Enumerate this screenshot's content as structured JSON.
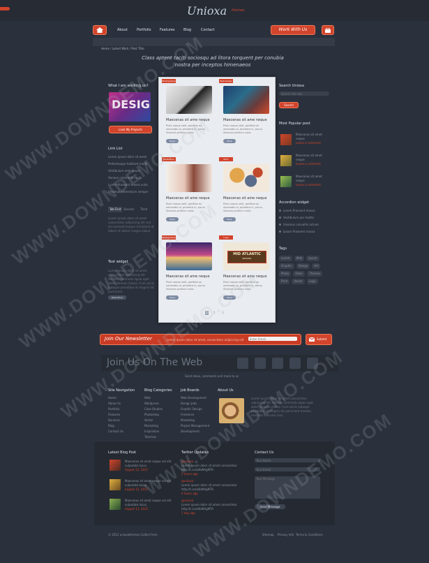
{
  "brand": {
    "logo": "Unioxa",
    "tagline": "themes"
  },
  "nav": {
    "items": [
      "About",
      "Portfolio",
      "Features",
      "Blog",
      "Contact"
    ],
    "cta": "Work With Us"
  },
  "breadcrumb": "Home / Latest Work / Post Title",
  "hero": {
    "line1": "Class aptent taciti sociosqu ad litora torquent per conubia",
    "line2": "nostra per inceptos himenaeos"
  },
  "left": {
    "working_title": "What I am working on?",
    "design_word": "DESIG",
    "working_button": "Look My Projects",
    "links_title": "Link List",
    "links": [
      "Lorem ipsum dolor sit amet",
      "Pellentesque habitant morbi",
      "Vestibulum ante ipsum",
      "Aenean commodo ligula",
      "Lorem Praesent massa nulla",
      "Vivamus elementum semper"
    ],
    "tabs": [
      "Tab First",
      "Second",
      "Third"
    ],
    "tab_text": "Lorem ipsum dolor sit amet consectetur adipiscing elit sed do eiusmod tempor incididunt ut labore et dolore magna aliqua",
    "text_widget_title": "Text widget",
    "text_widget_body": "Lorem ipsum dolor sit amet, consectetur adipiscing elit. Aenean commodo ligula eget dolor. Aenean massa. Cum sociis natoque penatibus et magnis dis parturient.",
    "text_widget_button": "Read More"
  },
  "cards": [
    {
      "title": "Maecenas sit ame neque",
      "excerpt": "Proin neque velit, porttitor ac venenatis ut, pharetra in, purus. Vivamus pretium nulla.",
      "more": "More",
      "tag": "Photography"
    },
    {
      "title": "Maecenas sit ame neque",
      "excerpt": "Proin neque velit, porttitor ac venenatis ut, pharetra in, purus. Vivamus pretium nulla.",
      "more": "More",
      "tag": "Web Design"
    },
    {
      "title": "Maecenas sit ame neque",
      "excerpt": "Proin neque velit, porttitor ac venenatis ut, pharetra in, purus. Vivamus pretium nulla.",
      "more": "More",
      "tag": "Illustration"
    },
    {
      "title": "Maecenas sit ame neque",
      "excerpt": "Proin neque velit, porttitor ac venenatis ut, pharetra in, purus. Vivamus pretium nulla.",
      "more": "More",
      "tag": "Print"
    },
    {
      "title": "Maecenas sit ame neque",
      "excerpt": "Proin neque velit, porttitor ac venenatis ut, pharetra in, purus. Vivamus pretium nulla.",
      "more": "More",
      "tag": "Photography"
    },
    {
      "title": "Maecenas sit ame neque",
      "excerpt": "Proin neque velit, porttitor ac venenatis ut, pharetra in, purus. Vivamus pretium nulla.",
      "more": "More",
      "tag": "Logo"
    }
  ],
  "badge_text": {
    "line1": "MID ATLANTIC",
    "line2": "BREWER"
  },
  "pager": [
    "1",
    "2",
    "3"
  ],
  "right": {
    "search_title": "Search Unioxa",
    "search_placeholder": "Search the site",
    "search_button": "Search",
    "popular_title": "Most Popular post",
    "popular": [
      {
        "title": "Maecenas sit amet neque",
        "meta": "Leave a comment"
      },
      {
        "title": "Maecenas sit amet neque",
        "meta": "Leave a comment"
      },
      {
        "title": "Maecenas sit amet neque",
        "meta": "Leave a comment"
      }
    ],
    "accordion_title": "Accordion widget",
    "accordion": [
      "Lorem Praesent massa",
      "Vestibulum per mattis",
      "Vivamus convallis rutrum",
      "Ipsum Praesent massa"
    ],
    "tags_title": "Tags",
    "tags": [
      "Lorem",
      "Web",
      "Ipsum",
      "Graphic",
      "Design",
      "Art",
      "Photo",
      "Dolor",
      "Themes",
      "Print",
      "Vector",
      "Logo"
    ]
  },
  "newsletter": {
    "title": "Join Our Newsletter",
    "text": "Lorem ipsum dolor sit amet, consectetur adipiscing elit",
    "placeholder": "Enter Email",
    "button": "Submit"
  },
  "social": {
    "title": "Join Us On The Web",
    "sub": "Send ideas, comments and more to us"
  },
  "footer_cols": [
    {
      "title": "Site Navigation",
      "items": [
        "Home",
        "About Us",
        "Portfolio",
        "Features",
        "Services",
        "Blog",
        "Contact Us"
      ]
    },
    {
      "title": "Blog Categories",
      "items": [
        "Web",
        "Wordpress",
        "Case Studies",
        "Photoshop",
        "Vector",
        "Marketing",
        "Inspiration",
        "Tutorials"
      ]
    },
    {
      "title": "Job Boards",
      "items": [
        "Web Development",
        "Design Jobs",
        "Graphic Design",
        "Freelance",
        "Marketing",
        "Project Management",
        "Development"
      ]
    }
  ],
  "about": {
    "title": "About Us",
    "text": "Lorem ipsum dolor sit amet consectetur adipiscing elit. Aenean commodo ligula eget dolor. Aenean massa. Cum sociis natoque penatibus et magnis dis parturient montes, nascetur ridiculus mus."
  },
  "latest": {
    "title": "Latest Blog Post",
    "posts": [
      {
        "title": "Maecenas sit amet neque vel elit vulputate lacus.",
        "date": "August 12, 2012"
      },
      {
        "title": "Maecenas sit amet neque vel elit vulputate lacus.",
        "date": "August 12, 2012"
      },
      {
        "title": "Maecenas sit amet neque vel elit vulputate lacus.",
        "date": "August 12, 2012"
      }
    ]
  },
  "twitter": {
    "title": "Twitter Updates",
    "tweets": [
      {
        "user": "@unioxa",
        "text": "Lorem ipsum dolor sit amet consectetur http://t.co/a0bWhgMTA",
        "time": "2 hours ago"
      },
      {
        "user": "@unioxa",
        "text": "Lorem ipsum dolor sit amet consectetur http://t.co/a0bWhgMTA",
        "time": "4 hours ago"
      },
      {
        "user": "@unioxa",
        "text": "Lorem ipsum dolor sit amet consectetur http://t.co/a0bWhgMTA",
        "time": "1 day ago"
      }
    ]
  },
  "contact": {
    "title": "Contact Us",
    "name": "Your Name",
    "email": "Your Email",
    "message": "Your Message",
    "send": "Send Message"
  },
  "bottom": {
    "copy": "© 2012 unioxathemes Collect from",
    "links": [
      "Sitemap",
      "Privacy Info",
      "Terms & Conditions"
    ]
  },
  "watermark": "WWW.DOWNDEMO.COM"
}
